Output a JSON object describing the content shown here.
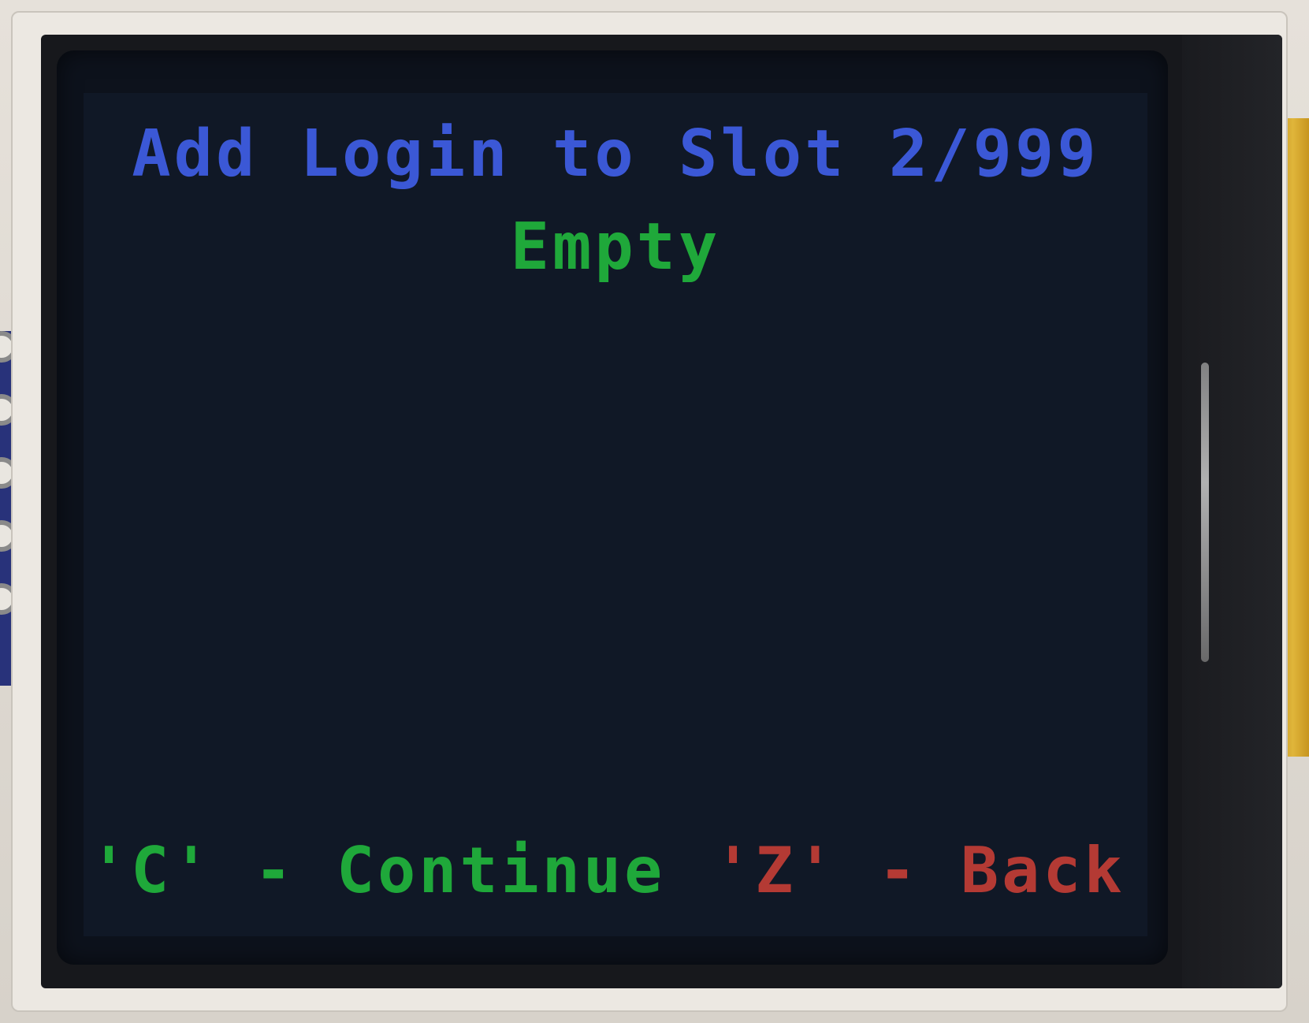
{
  "screen": {
    "title": "Add Login to Slot 2/999",
    "status": "Empty",
    "continue_hint": "'C' - Continue",
    "back_hint": "'Z' - Back"
  },
  "colors": {
    "title": "#3b58d6",
    "status": "#1fa83a",
    "continue": "#1fa83a",
    "back": "#b43a34",
    "background": "#101826"
  }
}
